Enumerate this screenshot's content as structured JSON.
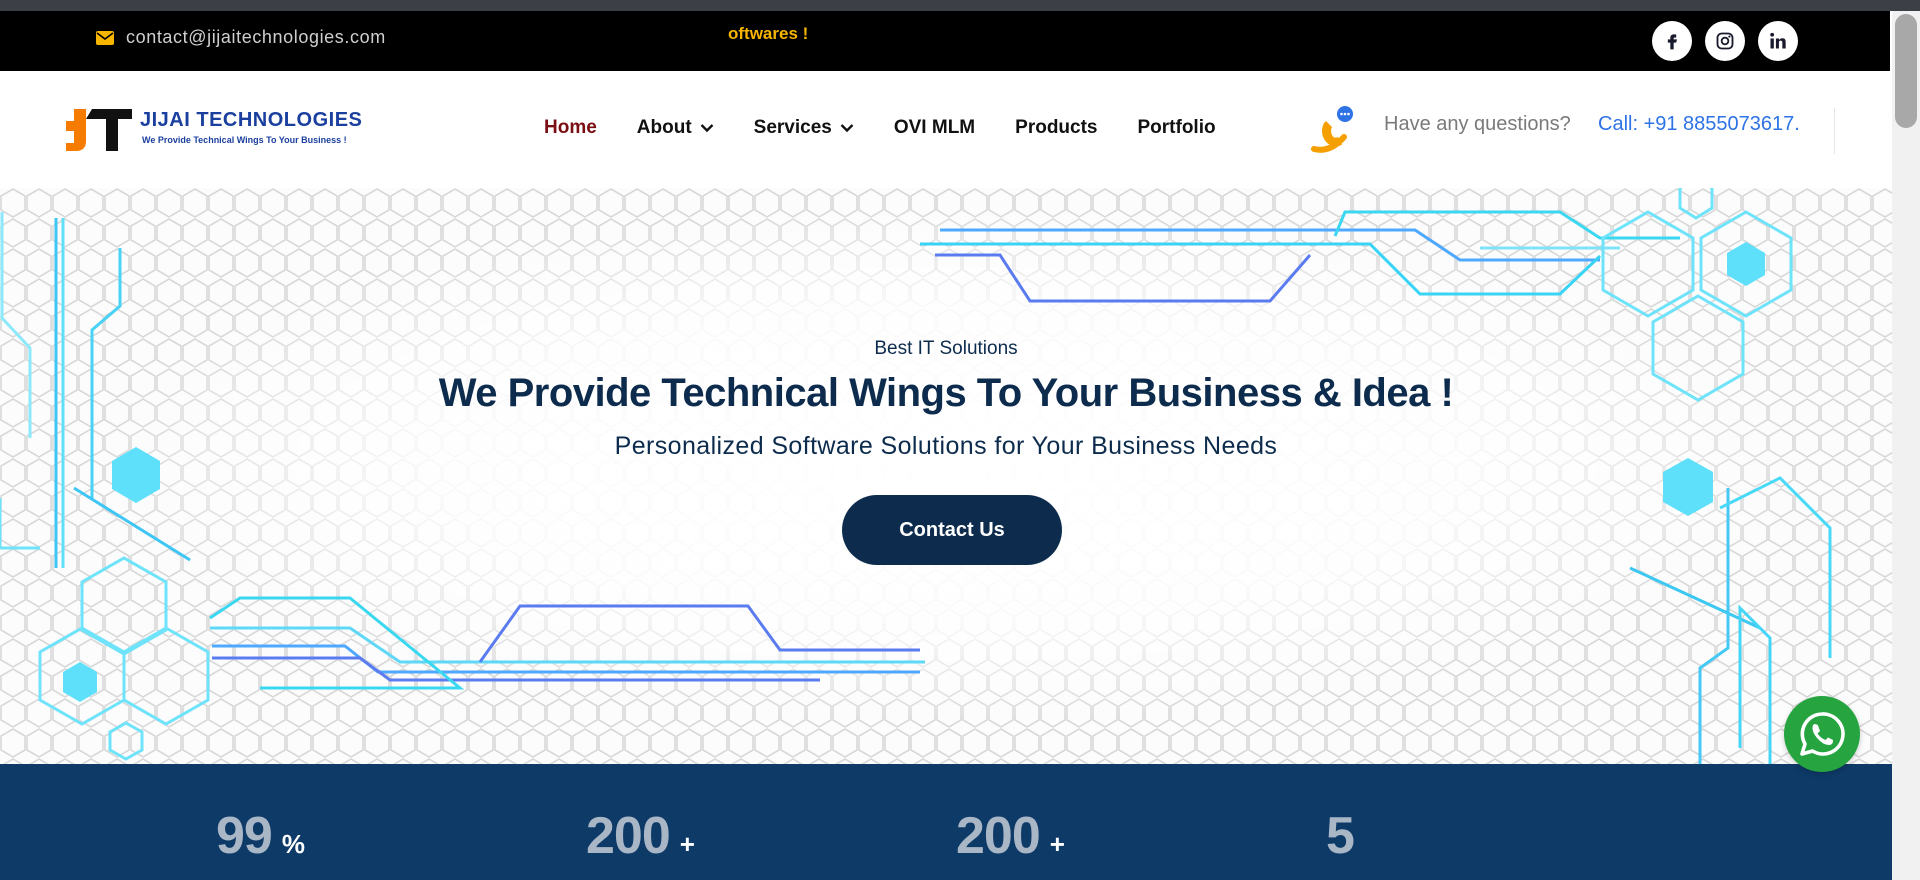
{
  "topbar": {
    "email": "contact@jijaitechnologies.com",
    "marquee": "oftwares !",
    "social": [
      "facebook-icon",
      "instagram-icon",
      "linkedin-icon"
    ]
  },
  "brand": {
    "name": "JIJAI TECHNOLOGIES",
    "tagline": "We Provide Technical Wings To Your Business !",
    "colors": {
      "primary": "#1a3f9e",
      "orange": "#f57c00"
    }
  },
  "nav": {
    "items": [
      {
        "label": "Home",
        "active": true
      },
      {
        "label": "About",
        "dropdown": true
      },
      {
        "label": "Services",
        "dropdown": true
      },
      {
        "label": "OVI MLM"
      },
      {
        "label": "Products"
      },
      {
        "label": "Portfolio"
      }
    ]
  },
  "contact": {
    "question": "Have any questions?",
    "call": "Call: +91 8855073617."
  },
  "hero": {
    "kicker": "Best IT Solutions",
    "title": "We Provide Technical Wings To Your Business & Idea !",
    "subtitle": "Personalized Software Solutions for Your Business Needs",
    "cta": "Contact Us"
  },
  "stats": [
    {
      "value": "99",
      "suffix": "%"
    },
    {
      "value": "200",
      "suffix": "+"
    },
    {
      "value": "200",
      "suffix": "+"
    },
    {
      "value": "5",
      "suffix": ""
    }
  ],
  "colors": {
    "navy": "#0d2c4d",
    "stats_bg": "#0e3a68",
    "link_blue": "#2e73e6",
    "accent_yellow": "#f7b500",
    "whatsapp": "#25a43f"
  }
}
